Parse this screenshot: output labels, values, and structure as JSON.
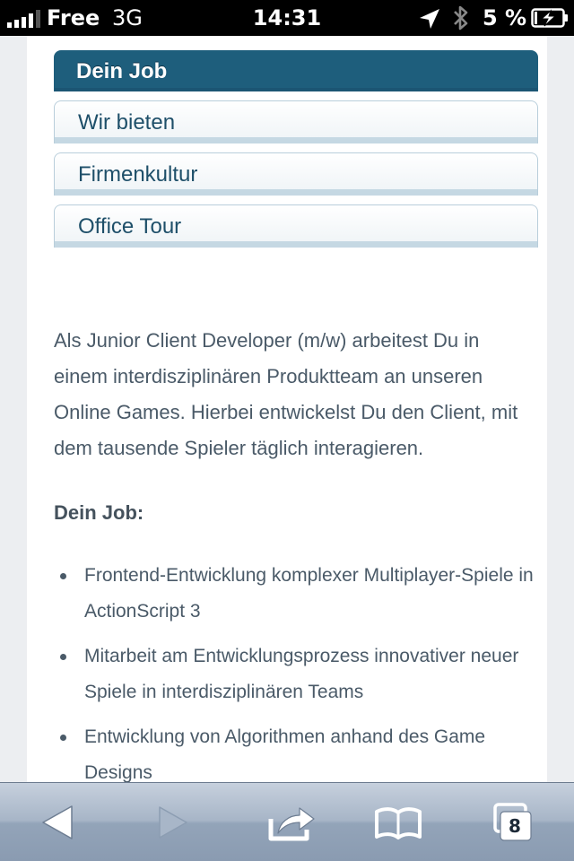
{
  "status_bar": {
    "carrier": "Free",
    "network": "3G",
    "time": "14:31",
    "battery_percent": "5 %",
    "icons": [
      "signal-bars-icon",
      "location-arrow-icon",
      "bluetooth-icon",
      "battery-charging-icon"
    ]
  },
  "job_nav": {
    "items": [
      {
        "label": "Dein Job",
        "active": true
      },
      {
        "label": "Wir bieten",
        "active": false
      },
      {
        "label": "Firmenkultur",
        "active": false
      },
      {
        "label": "Office Tour",
        "active": false
      }
    ]
  },
  "article": {
    "intro": "Als Junior Client Developer (m/w) arbeitest Du in einem interdisziplinären Produktteam an unseren Online Games. Hierbei entwickelst Du den Client, mit dem tausende Spieler täglich interagieren.",
    "job_heading": "Dein Job:",
    "job_list": [
      "Frontend-Entwicklung komplexer Multiplayer-Spiele in ActionScript 3",
      "Mitarbeit am Entwicklungsprozess innovativer neuer Spiele in interdisziplinären Teams",
      "Entwicklung von Algorithmen anhand des Game Designs"
    ]
  },
  "toolbar": {
    "tabs_count": "8",
    "icons": [
      "back-arrow-icon",
      "forward-arrow-icon",
      "share-icon",
      "bookmarks-book-icon",
      "tabs-icon"
    ]
  },
  "colors": {
    "nav_active": "#1e5e7c",
    "nav_text": "#1e4f69",
    "body_text": "#4a5a68",
    "toolbar": "#a7b5c7"
  }
}
